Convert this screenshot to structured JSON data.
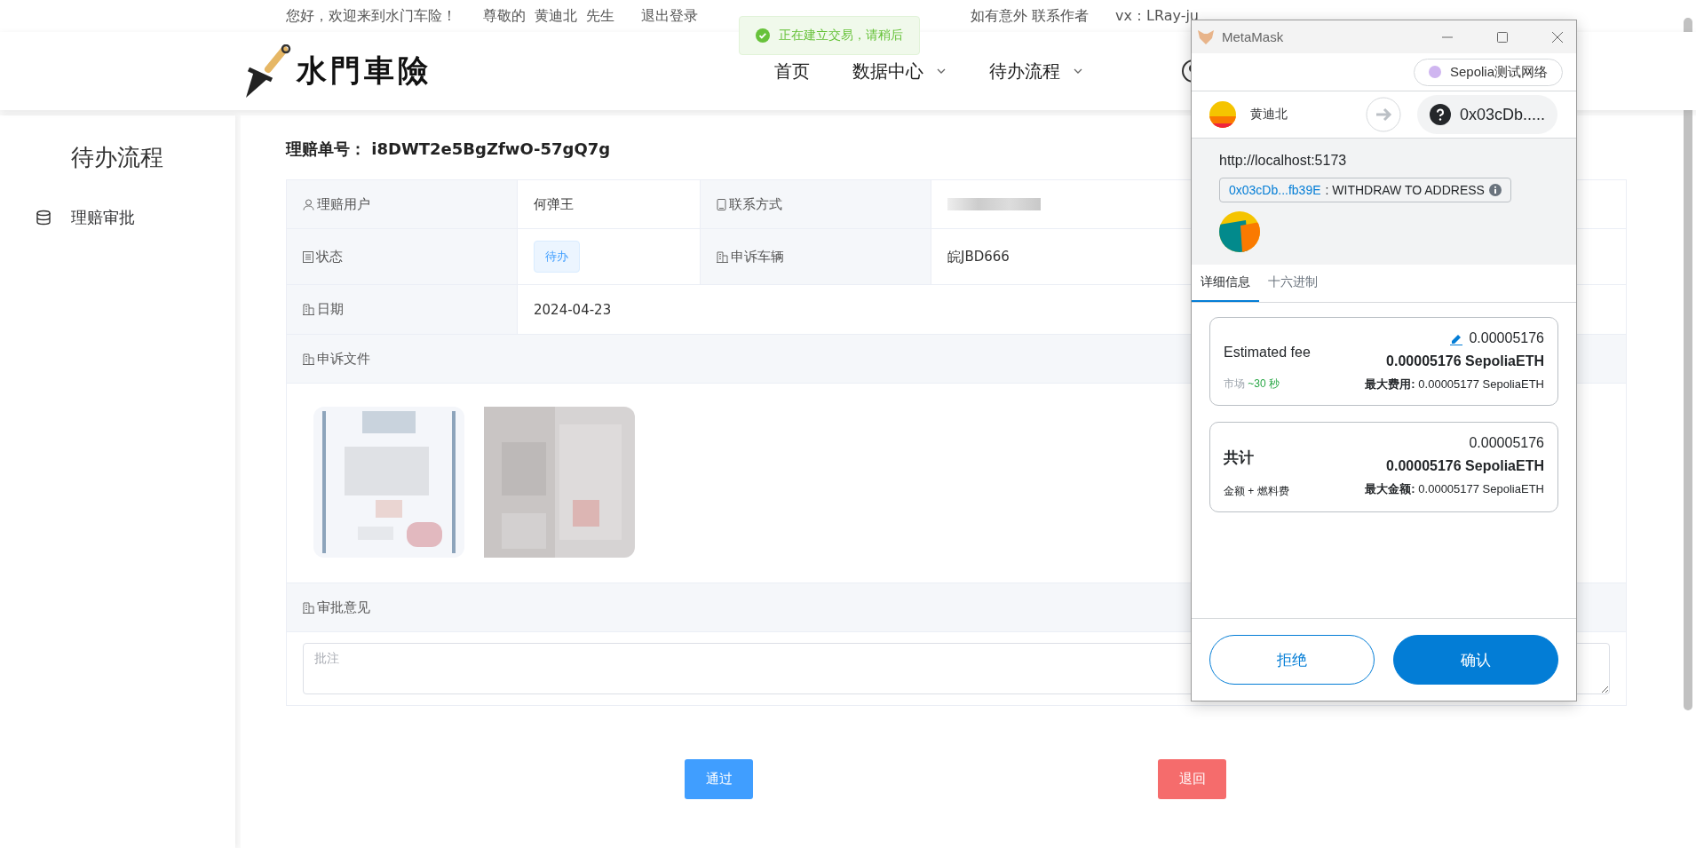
{
  "top_bar": {
    "greeting": "您好，欢迎来到水门车险！",
    "salutation": "尊敬的",
    "user": "黄迪北",
    "honorific": "先生",
    "logout": "退出登录",
    "contact": "如有意外 联系作者",
    "wechat": "vx：LRay-ju"
  },
  "toast": {
    "message": "正在建立交易，请稍后"
  },
  "header": {
    "logo": "水門車險",
    "nav": [
      {
        "label": "首页",
        "dropdown": false
      },
      {
        "label": "数据中心",
        "dropdown": true
      },
      {
        "label": "待办流程",
        "dropdown": true
      }
    ]
  },
  "sidebar": {
    "title": "待办流程",
    "items": [
      {
        "label": "理赔审批"
      }
    ]
  },
  "claim": {
    "label": "理赔单号：",
    "number": "i8DWT2e5BgZfwO-57gQ7g"
  },
  "details": [
    {
      "label": "理赔用户",
      "value": "何弹王",
      "label2": "联系方式",
      "redacted": true
    },
    {
      "label": "状态",
      "status": "待办",
      "label2": "申诉车辆",
      "value2": "皖JBD666"
    },
    {
      "label": "日期",
      "value": "2024-04-23"
    }
  ],
  "files": {
    "label": "申诉文件"
  },
  "approval": {
    "label": "审批意见",
    "placeholder": "批注"
  },
  "actions": {
    "approve": "通过",
    "reject": "退回"
  },
  "metamask": {
    "title": "MetaMask",
    "network": "Sepolia测试网络",
    "from": "黄迪北",
    "to": "0x03cDb.....",
    "origin": "http://localhost:5173",
    "contract": "0x03cDb...fb39E",
    "method": ": WITHDRAW TO ADDRESS",
    "tabs": [
      {
        "label": "详细信息",
        "selected": true
      },
      {
        "label": "十六进制",
        "selected": false
      }
    ],
    "fee": {
      "label": "Estimated fee",
      "amount": "0.00005176",
      "amount_eth": "0.00005176 SepoliaETH",
      "speed": "市场",
      "time": "~30 秒",
      "max_label": "最大费用:",
      "max": "0.00005177 SepoliaETH"
    },
    "total": {
      "label": "共计",
      "amount": "0.00005176",
      "amount_eth": "0.00005176 SepoliaETH",
      "sub": "金额 + 燃料费",
      "max_label": "最大金额:",
      "max": "0.00005177 SepoliaETH"
    },
    "reject": "拒绝",
    "confirm": "确认"
  }
}
